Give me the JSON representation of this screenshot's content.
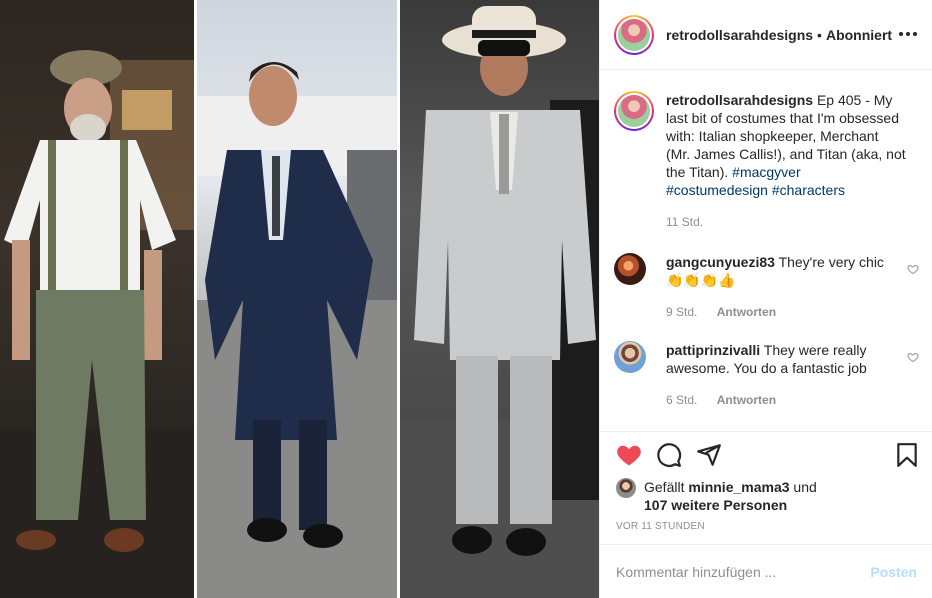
{
  "header": {
    "username": "retrodollsarahdesigns",
    "separator": "•",
    "follow_state": "Abonniert"
  },
  "caption": {
    "username": "retrodollsarahdesigns",
    "text": "Ep 405 - My last bit of costumes that I'm obsessed with: Italian shopkeeper, Merchant (Mr. James Callis!), and Titan (aka, not the Titan). ",
    "tags": [
      "#macgyver",
      "#costumedesign",
      "#characters"
    ],
    "time": "11 Std."
  },
  "comments": [
    {
      "username": "gangcunyuezi83",
      "text": "They're very chic",
      "emoji": "👏👏👏👍",
      "time": "9 Std.",
      "reply_label": "Antworten"
    },
    {
      "username": "pattiprinzivalli",
      "text": "They were really awesome. You do a fantastic job",
      "time": "6 Std.",
      "reply_label": "Antworten"
    }
  ],
  "likes": {
    "prefix": "Gefällt",
    "user": "minnie_mama3",
    "middle": "und",
    "others": "107 weitere Personen"
  },
  "posted_ago": "VOR 11 STUNDEN",
  "composer": {
    "placeholder": "Kommentar hinzufügen ...",
    "post_label": "Posten"
  },
  "colors": {
    "like_red": "#ed4956",
    "hashtag": "#00376b",
    "post_disabled": "#b2dffc",
    "muted": "#8e8e8e"
  },
  "icons": [
    "more-options-icon",
    "heart-filled-icon",
    "comment-icon",
    "share-icon",
    "bookmark-icon",
    "heart-outline-icon"
  ]
}
